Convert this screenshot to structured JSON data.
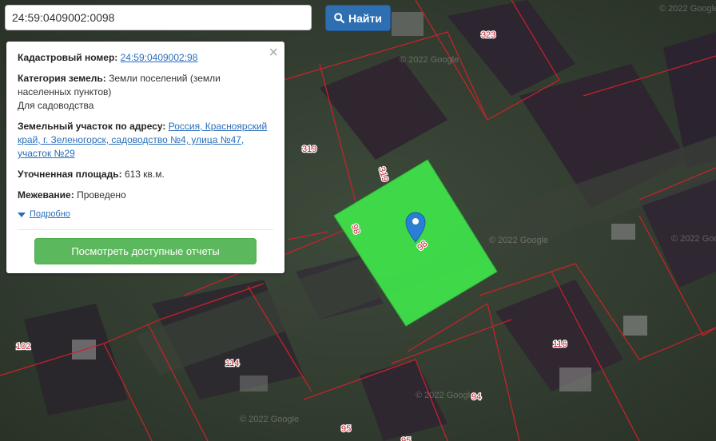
{
  "search": {
    "value": "24:59:0409002:0098",
    "button_label": "Найти"
  },
  "info": {
    "cadastral_label": "Кадастровый номер:",
    "cadastral_value": "24:59:0409002:98",
    "category_label": "Категория земель:",
    "category_value": "Земли поселений (земли населенных пунктов)",
    "usage_value": "Для садоводства",
    "address_label": "Земельный участок по адресу:",
    "address_value": "Россия, Красноярский край, г. Зеленогорск, садоводство №4, улица №47, участок №29",
    "area_label": "Уточненная площадь:",
    "area_value": "613 кв.м.",
    "survey_label": "Межевание:",
    "survey_value": "Проведено",
    "more_label": "Подробно",
    "reports_button": "Посмотреть доступные отчеты"
  },
  "map": {
    "parcel_labels": [
      "323",
      "319",
      "319",
      "98",
      "98",
      "102",
      "114",
      "116",
      "94",
      "95",
      "95"
    ],
    "watermark": "© 2022 Google",
    "colors": {
      "selected_parcel": "#3fe04a",
      "boundary": "#d0202a",
      "marker": "#2a7fd4",
      "search_button": "#2e6fb2",
      "reports_button": "#5cb85c"
    },
    "icons": [
      "search-icon",
      "close-icon",
      "map-marker-icon",
      "caret-down-icon"
    ]
  }
}
